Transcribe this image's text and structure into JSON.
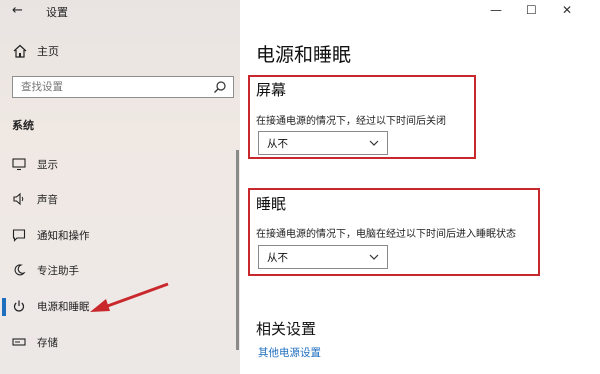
{
  "window": {
    "title": "设置",
    "back_glyph": "←",
    "minimize_glyph": "—",
    "maximize_glyph": "☐",
    "close_glyph": "✕"
  },
  "sidebar": {
    "home_label": "主页",
    "search_placeholder": "查找设置",
    "section_label": "系统",
    "items": [
      {
        "label": "显示",
        "icon": "display-icon"
      },
      {
        "label": "声音",
        "icon": "speaker-icon"
      },
      {
        "label": "通知和操作",
        "icon": "notification-icon"
      },
      {
        "label": "专注助手",
        "icon": "moon-icon"
      },
      {
        "label": "电源和睡眠",
        "icon": "power-icon",
        "active": true
      },
      {
        "label": "存储",
        "icon": "storage-icon"
      }
    ]
  },
  "main": {
    "title": "电源和睡眠",
    "screen": {
      "heading": "屏幕",
      "description": "在接通电源的情况下，经过以下时间后关闭",
      "value": "从不"
    },
    "sleep": {
      "heading": "睡眠",
      "description": "在接通电源的情况下，电脑在经过以下时间后进入睡眠状态",
      "value": "从不"
    },
    "related": {
      "heading": "相关设置",
      "link": "其他电源设置"
    }
  },
  "colors": {
    "accent": "#1f6fbf",
    "annotation_red": "#c8282c"
  }
}
